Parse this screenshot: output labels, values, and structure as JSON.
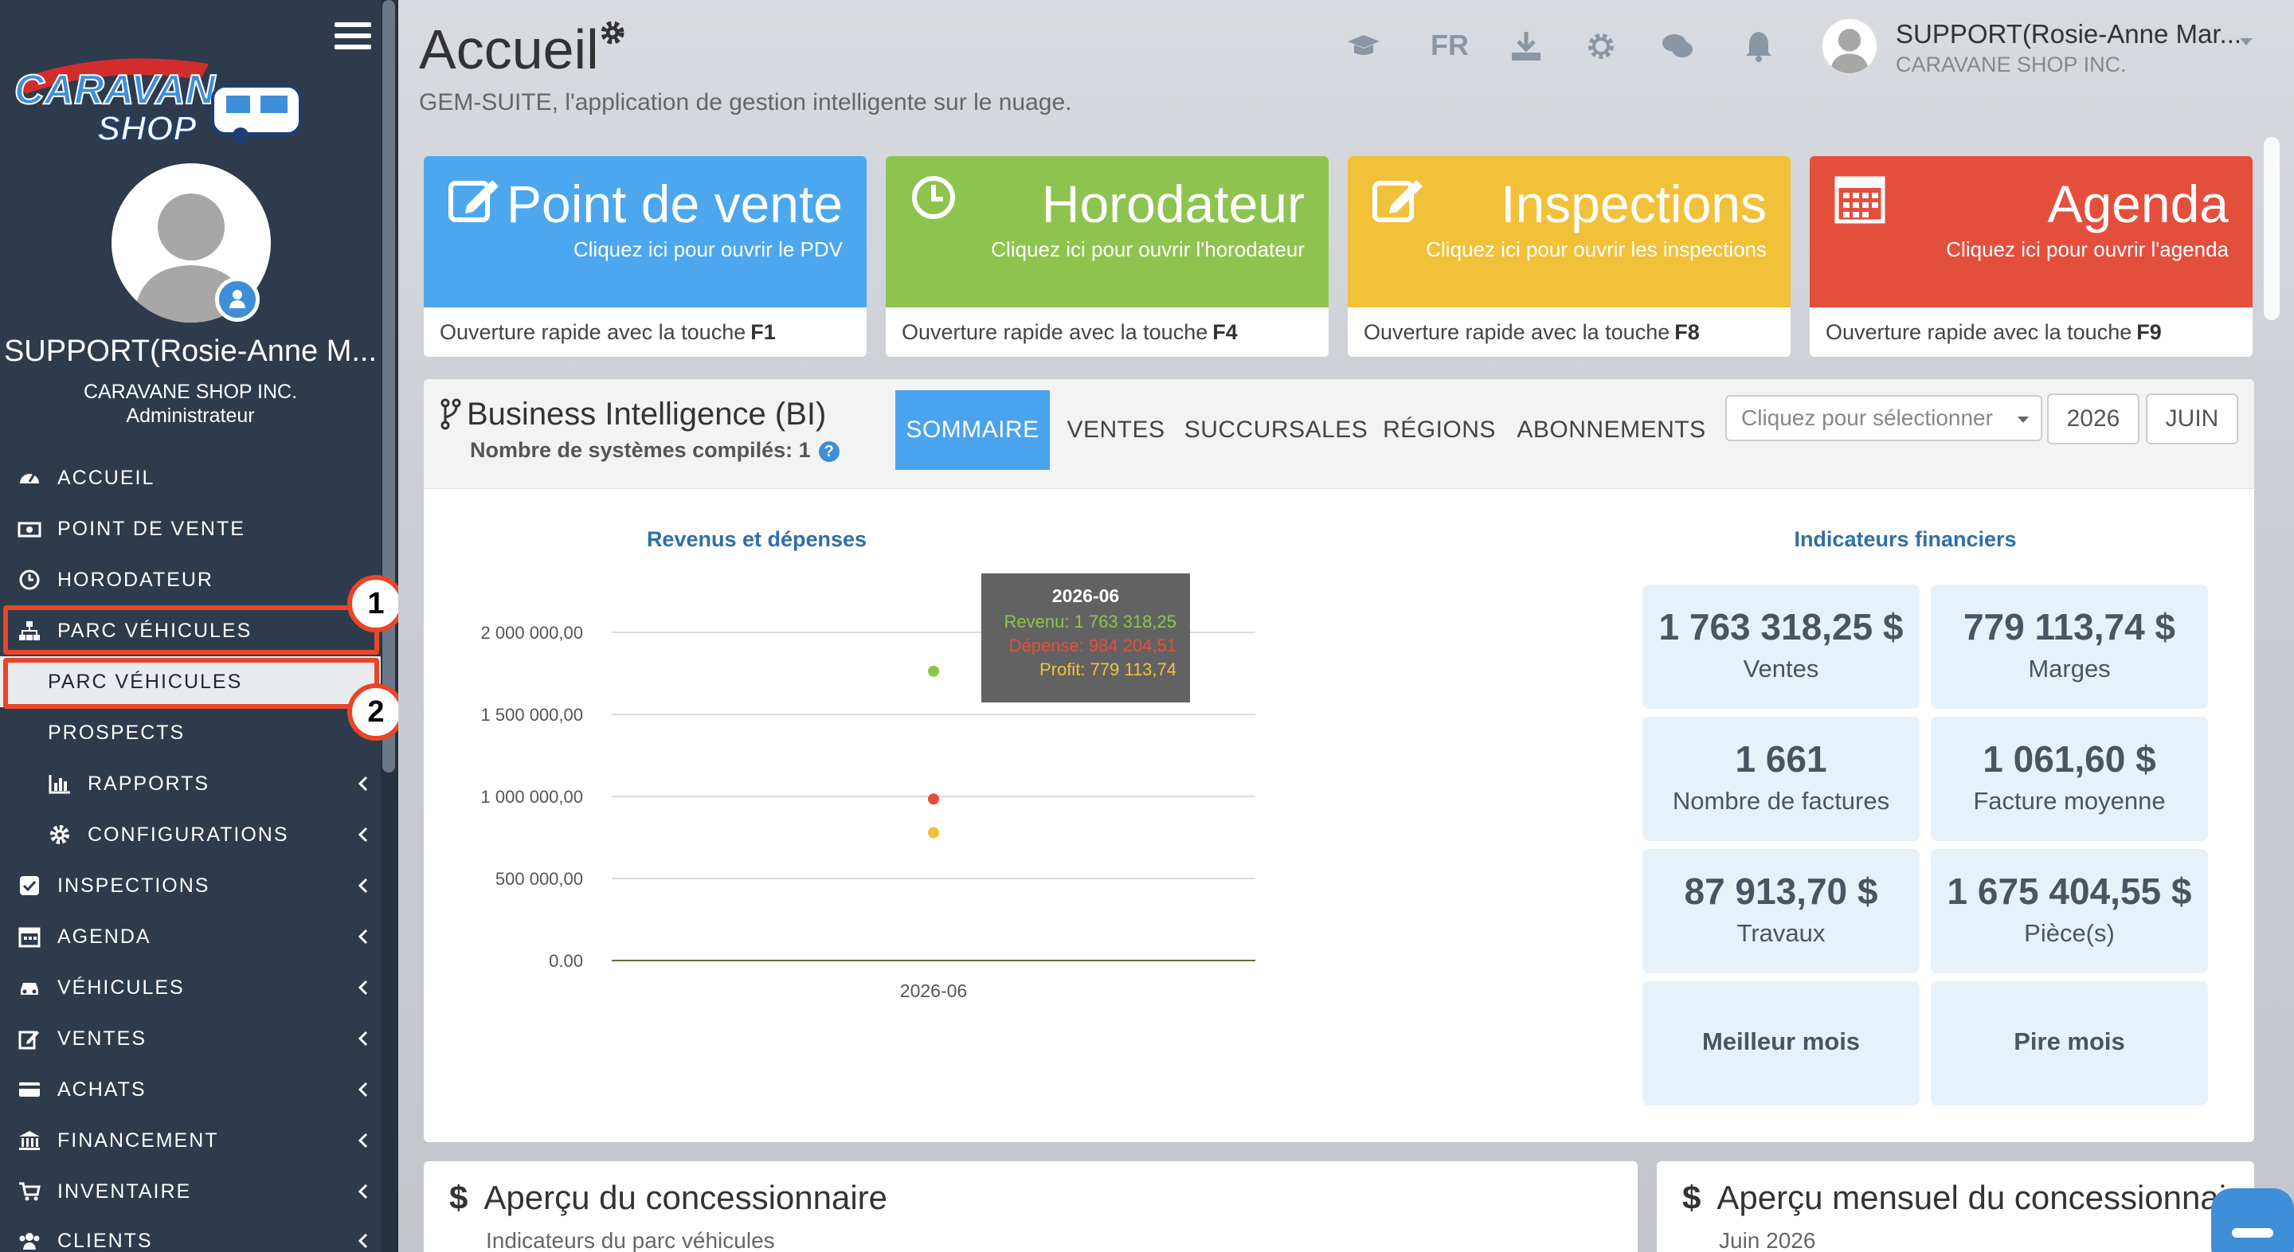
{
  "sidebar": {
    "logo_text": "CARAVAN SHOP",
    "user_name": "SUPPORT(Rosie-Anne M...",
    "company": "CARAVANE SHOP INC.",
    "role": "Administrateur",
    "items": [
      {
        "label": "ACCUEIL",
        "icon": "dashboard-icon"
      },
      {
        "label": "POINT DE VENTE",
        "icon": "cash-register-icon"
      },
      {
        "label": "HORODATEUR",
        "icon": "clock-icon"
      },
      {
        "label": "PARC VÉHICULES",
        "icon": "sitemap-icon"
      },
      {
        "label": "PARC VÉHICULES",
        "icon": ""
      },
      {
        "label": "PROSPECTS",
        "icon": ""
      },
      {
        "label": "RAPPORTS",
        "icon": "bar-chart-icon"
      },
      {
        "label": "CONFIGURATIONS",
        "icon": "gear-icon"
      },
      {
        "label": "INSPECTIONS",
        "icon": "check-square-icon"
      },
      {
        "label": "AGENDA",
        "icon": "calendar-icon"
      },
      {
        "label": "VÉHICULES",
        "icon": "car-icon"
      },
      {
        "label": "VENTES",
        "icon": "edit-icon"
      },
      {
        "label": "ACHATS",
        "icon": "credit-card-icon"
      },
      {
        "label": "FINANCEMENT",
        "icon": "bank-icon"
      },
      {
        "label": "INVENTAIRE",
        "icon": "cart-icon"
      },
      {
        "label": "CLIENTS",
        "icon": "users-icon"
      }
    ]
  },
  "annotations": {
    "step1": "1",
    "step2": "2"
  },
  "header": {
    "title": "Accueil",
    "subtitle": "GEM-SUITE, l'application de gestion intelligente sur le nuage.",
    "lang": "FR",
    "user_name": "SUPPORT(Rosie-Anne Mar...",
    "company": "CARAVANE SHOP INC."
  },
  "tiles": [
    {
      "title": "Point de vente",
      "subtitle": "Cliquez ici pour ouvrir le PDV",
      "footer": "Ouverture rapide avec la touche",
      "key": "F1",
      "color": "#4ca7ee"
    },
    {
      "title": "Horodateur",
      "subtitle": "Cliquez ici pour ouvrir l'horodateur",
      "footer": "Ouverture rapide avec la touche",
      "key": "F4",
      "color": "#8fc350"
    },
    {
      "title": "Inspections",
      "subtitle": "Cliquez ici pour ouvrir les inspections",
      "footer": "Ouverture rapide avec la touche",
      "key": "F8",
      "color": "#f2c13a"
    },
    {
      "title": "Agenda",
      "subtitle": "Cliquez ici pour ouvrir l'agenda",
      "footer": "Ouverture rapide avec la touche",
      "key": "F9",
      "color": "#e44f3d"
    }
  ],
  "bi": {
    "title": "Business Intelligence (BI)",
    "subtitle": "Nombre de systèmes compilés: 1",
    "tabs": [
      "SOMMAIRE",
      "VENTES",
      "SUCCURSALES",
      "RÉGIONS",
      "ABONNEMENTS"
    ],
    "select_placeholder": "Cliquez pour sélectionner",
    "year": "2026",
    "month": "JUIN",
    "chart_title": "Revenus et dépenses",
    "fin_title": "Indicateurs financiers",
    "tooltip": {
      "title": "2026-06",
      "revenu": "Revenu: 1 763 318,25",
      "depense": "Dépense: 984 204,51",
      "profit": "Profit: 779 113,74"
    },
    "stats": [
      {
        "value": "1 763 318,25 $",
        "label": "Ventes"
      },
      {
        "value": "779 113,74 $",
        "label": "Marges"
      },
      {
        "value": "1 661",
        "label": "Nombre de factures"
      },
      {
        "value": "1 061,60 $",
        "label": "Facture moyenne"
      },
      {
        "value": "87 913,70 $",
        "label": "Travaux"
      },
      {
        "value": "1 675 404,55 $",
        "label": "Pièce(s)"
      },
      {
        "value": "",
        "label": "Meilleur mois"
      },
      {
        "value": "",
        "label": "Pire mois"
      }
    ]
  },
  "cards": [
    {
      "title": "Aperçu du concessionnaire",
      "subtitle": "Indicateurs du parc véhicules"
    },
    {
      "title": "Aperçu mensuel du concessionnaire",
      "subtitle": "Juin 2026"
    }
  ],
  "chart_data": {
    "type": "scatter",
    "title": "Revenus et dépenses",
    "categories": [
      "2026-06"
    ],
    "y_tick_labels": [
      "0.00",
      "500 000,00",
      "1 000 000,00",
      "1 500 000,00",
      "2 000 000,00"
    ],
    "ylim": [
      0,
      2000000
    ],
    "series": [
      {
        "name": "Revenu",
        "values": [
          1763318.25
        ],
        "color": "#8fc350"
      },
      {
        "name": "Dépense",
        "values": [
          984204.51
        ],
        "color": "#e44f3d"
      },
      {
        "name": "Profit",
        "values": [
          779113.74
        ],
        "color": "#f2c13a"
      }
    ]
  }
}
